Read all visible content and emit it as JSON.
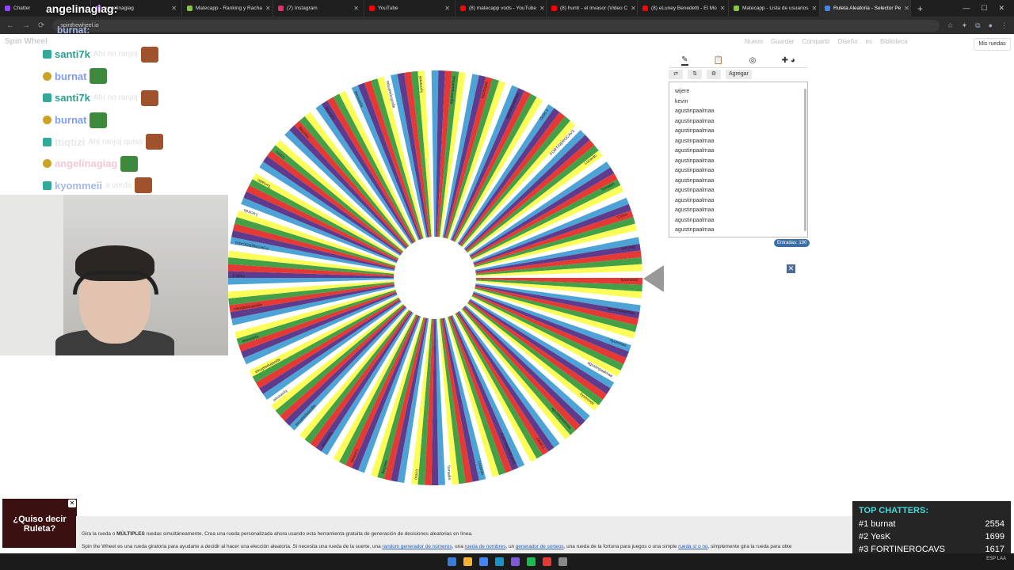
{
  "browser": {
    "tabs": [
      {
        "title": "Chatter",
        "color": "#9146ff"
      },
      {
        "title": "angelinagiag",
        "color": "#9146ff"
      },
      {
        "title": "Matecapp - Ranking y Racha",
        "color": "#8bc34a"
      },
      {
        "title": "(7) Instagram",
        "color": "#e1306c"
      },
      {
        "title": "YouTube",
        "color": "#ff0000"
      },
      {
        "title": "(8) matecapp vods - YouTube",
        "color": "#ff0000"
      },
      {
        "title": "(8) huntr - el invasor (Video C",
        "color": "#ff0000"
      },
      {
        "title": "(8) eLuney Benedetti - El Mo",
        "color": "#ff0000"
      },
      {
        "title": "Matecapp - Lista de usuarios",
        "color": "#8bc34a"
      },
      {
        "title": "Ruleta Aleatoria - Selector Pe",
        "color": "#4285f4"
      }
    ],
    "url": "spinthewheel.io",
    "active_tab": 9
  },
  "app": {
    "logo": "Spin Wheel",
    "toolbar": [
      "Nuevo",
      "Guardar",
      "Compartir",
      "Diseño",
      "es",
      "Biblioteca"
    ],
    "my_wheels": "Mis ruedas",
    "add_button": "Agregar",
    "entries": [
      "wijere",
      "kevin",
      "agustinpaalmaa",
      "agustinpaalmaa",
      "agustinpaalmaa",
      "agustinpaalmaa",
      "agustinpaalmaa",
      "agustinpaalmaa",
      "agustinpaalmaa",
      "agustinpaalmaa",
      "agustinpaalmaa",
      "agustinpaalmaa",
      "agustinpaalmaa",
      "agustinpaalmaa",
      "agustinpaalmaa",
      "agustinpaalmaa"
    ],
    "entries_count": "Entradas: 190",
    "wheel_colors": [
      "#e53935",
      "#43a047",
      "#fdfd5a",
      "#ffffff",
      "#4ea3d6",
      "#5e3b8c"
    ],
    "wheel_segments": 190,
    "wheel_labels": [
      "kyommeii",
      "agustinpaalmaa",
      "kyommeii",
      "agustinpaalmaa",
      "kyommeii",
      "agustinpaalmaa",
      "Ocdo 1",
      "FORTINEROCAVS",
      "Lucardo",
      "Tomadin",
      "Como",
      "mechag",
      "Lucardo"
    ]
  },
  "chat": {
    "top_user": "angelinagiag:",
    "header_user": "burnat:",
    "messages": [
      {
        "user": "santi7k",
        "text": "Ahí no ranjoj",
        "color": "#2a9d8f"
      },
      {
        "user": "burnat",
        "text": "",
        "color": "#7f9cf5"
      },
      {
        "user": "santi7k",
        "text": "Ahí no ranjoj",
        "color": "#2a9d8f"
      },
      {
        "user": "burnat",
        "text": "",
        "color": "#7f9cf5"
      },
      {
        "user": "ttiqtizi",
        "text": "Ahí ranjoj quiso",
        "color": "#e8e8e8"
      },
      {
        "user": "angelinagiag",
        "text": "",
        "color": "#f0c8d8"
      },
      {
        "user": "kyommeii",
        "text": "a verda",
        "color": "#a7b7e8"
      }
    ]
  },
  "overlay": {
    "quiso": "¿Quiso decir Ruleta?",
    "top_chatters_title": "TOP CHATTERS:",
    "top_chatters": [
      {
        "rank": "#1",
        "name": "burnat",
        "score": "2554"
      },
      {
        "rank": "#2",
        "name": "YesK",
        "score": "1699"
      },
      {
        "rank": "#3",
        "name": "FORTINEROCAVS",
        "score": "1617"
      }
    ]
  },
  "footer": {
    "line1_pre": "Gira la rueda o ",
    "line1_bold": "MÚLTIPLES",
    "line1_post": " ruedas simultáneamente. Crea una rueda personalizada ahora usando esta herramienta gratuita de generación de decisiones aleatorias en línea.",
    "line2_pre": "Spin the Wheel es una rueda giratoria para ayudarte a decidir al hacer una elección aleatoria. Si necesita una rueda de la suerte, una ",
    "link1": "random generador de números",
    "line2_mid1": ", una ",
    "link2": "rueda de nombres",
    "line2_mid2": ", un ",
    "link3": "generador de sorteos",
    "line2_mid3": ", una rueda de la fortuna para juegos o una simple ",
    "link4": "rueda sí o no",
    "line2_post": ", simplemente gira la rueda para obte"
  },
  "taskbar": {
    "icons": [
      "#3b7bd8",
      "#f2b233",
      "#4285f4",
      "#1e90c8",
      "#7b5cd6",
      "#1db954",
      "#e53935",
      "#888"
    ],
    "time": "ESP LAA"
  }
}
